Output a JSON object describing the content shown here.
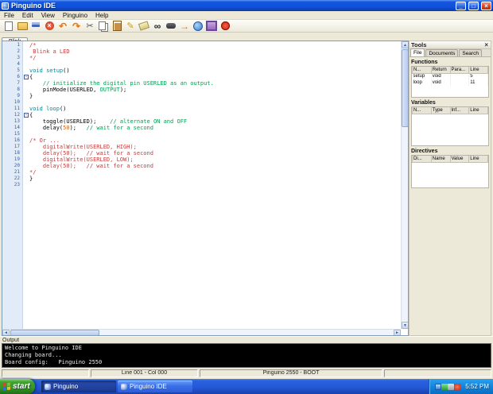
{
  "window": {
    "title": "Pinguino IDE",
    "controls": {
      "minimize": "_",
      "maximize": "□",
      "close": "×"
    }
  },
  "menu": {
    "items": [
      "File",
      "Edit",
      "View",
      "Pinguino",
      "Help"
    ]
  },
  "toolbar": {
    "icons": [
      "new-file",
      "open-file",
      "save-file",
      "close-file",
      "undo",
      "redo",
      "cut",
      "copy",
      "paste",
      "format",
      "clear",
      "find",
      "compile",
      "upload",
      "web",
      "screenshot",
      "exit"
    ]
  },
  "editor": {
    "tab": "Blink",
    "lines": [
      {
        "num": 1,
        "segs": [
          [
            "/*",
            "cmt-red"
          ]
        ]
      },
      {
        "num": 2,
        "segs": [
          [
            " Blink a LED",
            "cmt-red"
          ]
        ]
      },
      {
        "num": 3,
        "segs": [
          [
            "*/",
            "cmt-red"
          ]
        ]
      },
      {
        "num": 4,
        "segs": []
      },
      {
        "num": 5,
        "segs": [
          [
            "void setup",
            "kw"
          ],
          [
            "()",
            "plain"
          ]
        ]
      },
      {
        "num": 6,
        "fold": true,
        "segs": [
          [
            "{",
            "plain"
          ]
        ]
      },
      {
        "num": 7,
        "segs": [
          [
            "    ",
            "plain"
          ],
          [
            "// initialize the digital pin USERLED as an output.",
            "cmt-green"
          ]
        ]
      },
      {
        "num": 8,
        "segs": [
          [
            "    pinMode(USERLED, ",
            "plain"
          ],
          [
            "OUTPUT",
            "kw2"
          ],
          [
            ");",
            "plain"
          ]
        ]
      },
      {
        "num": 9,
        "segs": [
          [
            "}",
            "plain"
          ]
        ]
      },
      {
        "num": 10,
        "segs": []
      },
      {
        "num": 11,
        "segs": [
          [
            "void loop",
            "kw"
          ],
          [
            "()",
            "plain"
          ]
        ]
      },
      {
        "num": 12,
        "fold": true,
        "segs": [
          [
            "{",
            "plain"
          ]
        ]
      },
      {
        "num": 13,
        "segs": [
          [
            "    toggle(USERLED);    ",
            "plain"
          ],
          [
            "// alternate ON and OFF",
            "cmt-green"
          ]
        ]
      },
      {
        "num": 14,
        "segs": [
          [
            "    delay(",
            "plain"
          ],
          [
            "50",
            "num"
          ],
          [
            ");   ",
            "plain"
          ],
          [
            "// wait for a second",
            "cmt-green"
          ]
        ]
      },
      {
        "num": 15,
        "segs": []
      },
      {
        "num": 16,
        "segs": [
          [
            "/* Or ...",
            "cmt-red"
          ]
        ]
      },
      {
        "num": 17,
        "segs": [
          [
            "    digitalWrite(USERLED, HIGH);",
            "cmt-red"
          ]
        ]
      },
      {
        "num": 18,
        "segs": [
          [
            "    delay(50);   // wait for a second",
            "cmt-red"
          ]
        ]
      },
      {
        "num": 19,
        "segs": [
          [
            "    digitalWrite(USERLED, LOW);",
            "cmt-red"
          ]
        ]
      },
      {
        "num": 20,
        "segs": [
          [
            "    delay(50);   // wait for a second",
            "cmt-red"
          ]
        ]
      },
      {
        "num": 21,
        "segs": [
          [
            "*/",
            "cmt-red"
          ]
        ]
      },
      {
        "num": 22,
        "segs": [
          [
            "}",
            "plain"
          ]
        ]
      },
      {
        "num": 23,
        "segs": []
      }
    ]
  },
  "tools": {
    "title": "Tools",
    "close": "×",
    "tabs": [
      {
        "label": "File",
        "active": true
      },
      {
        "label": "Documents",
        "active": false
      },
      {
        "label": "Search",
        "active": false
      }
    ],
    "sections": [
      {
        "title": "Functions",
        "headers": [
          "N...",
          "Return",
          "Para...",
          "Line"
        ],
        "rows": [
          [
            "setup",
            "void",
            "",
            "5"
          ],
          [
            "loop",
            "void",
            "",
            "11"
          ]
        ]
      },
      {
        "title": "Variables",
        "headers": [
          "N...",
          "Type",
          "Inf...",
          "Line"
        ],
        "rows": []
      },
      {
        "title": "Directives",
        "headers": [
          "Di...",
          "Name",
          "Value",
          "Line"
        ],
        "rows": []
      }
    ]
  },
  "output": {
    "title": "Output",
    "lines": [
      "Welcome to Pinguino IDE",
      "Changing board...",
      "Board config:   Pinguino 2550"
    ]
  },
  "statusbar": {
    "segments": [
      "",
      "Line 001 - Col 000",
      "Pinguino 2550 - BOOT",
      ""
    ]
  },
  "taskbar": {
    "start_label": "start",
    "buttons": [
      {
        "label": "Pinguino",
        "active": true
      },
      {
        "label": "Pinguino IDE",
        "active": false
      }
    ],
    "tray_icons": [
      "tray-display",
      "tray-network",
      "tray-volume",
      "tray-antivirus"
    ],
    "clock": "5:52 PM"
  },
  "colors": {
    "titlebar_blue": "#1152DC",
    "taskbar_blue": "#2458D6",
    "start_green": "#379428",
    "keyword_teal": "#00889C",
    "comment_green": "#00A050",
    "comment_red": "#C04040",
    "number_orange": "#D06010",
    "output_bg": "#000000"
  }
}
